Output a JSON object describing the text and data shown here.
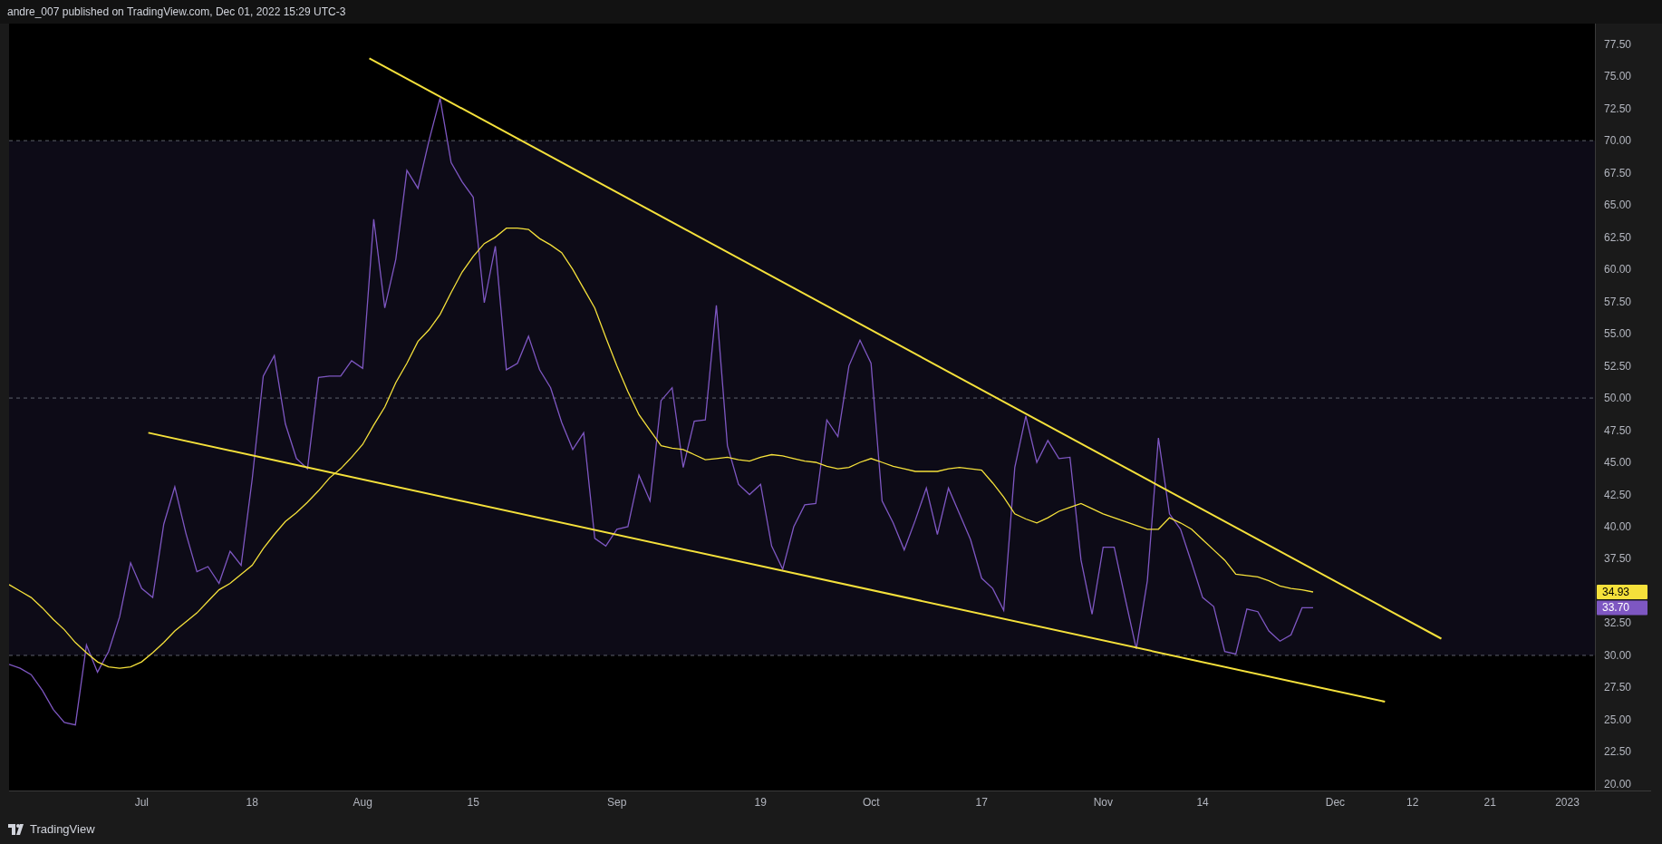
{
  "header": {
    "text": "andre_007 published on TradingView.com, Dec 01, 2022 15:29 UTC-3"
  },
  "chart": {
    "chart_data": {
      "type": "line",
      "categories": [
        null,
        null,
        null,
        null,
        null,
        null,
        null,
        null,
        null,
        null,
        null,
        null,
        "Jul",
        null,
        null,
        null,
        null,
        null,
        null,
        null,
        null,
        null,
        "18",
        null,
        null,
        null,
        null,
        null,
        null,
        null,
        null,
        null,
        "Aug",
        null,
        null,
        null,
        null,
        null,
        null,
        null,
        null,
        null,
        "15",
        null,
        null,
        null,
        null,
        null,
        null,
        null,
        null,
        null,
        null,
        null,
        null,
        "Sep",
        null,
        null,
        null,
        null,
        null,
        null,
        null,
        null,
        null,
        null,
        null,
        null,
        "19",
        null,
        null,
        null,
        null,
        null,
        null,
        null,
        null,
        null,
        "Oct",
        null,
        null,
        null,
        null,
        null,
        null,
        null,
        null,
        null,
        "17",
        null,
        null,
        null,
        null,
        null,
        null,
        null,
        null,
        null,
        null,
        "Nov",
        null,
        null,
        null,
        null,
        null,
        null,
        null,
        null,
        "14",
        null,
        null,
        null,
        null,
        null,
        null,
        null,
        null,
        null,
        null,
        null,
        "Dec",
        null,
        null,
        null,
        null,
        null,
        null,
        "12",
        null,
        null,
        null,
        null,
        null,
        null,
        "21",
        null,
        null,
        null,
        null,
        null,
        null,
        "2023"
      ],
      "series": [
        {
          "color": "#7e57c2",
          "values": [
            29.3,
            29.0,
            28.5,
            27.3,
            25.8,
            24.8,
            24.6,
            30.8,
            28.7,
            30.3,
            33.0,
            37.2,
            35.2,
            34.5,
            40.2,
            43.1,
            39.5,
            36.5,
            36.9,
            35.6,
            38.1,
            37.0,
            43.7,
            51.7,
            53.3,
            48.0,
            45.3,
            44.5,
            51.6,
            51.7,
            51.7,
            52.9,
            52.3,
            63.9,
            57.0,
            60.8,
            67.7,
            66.3,
            70.0,
            73.3,
            68.3,
            66.8,
            65.6,
            57.4,
            61.8,
            52.2,
            52.7,
            54.8,
            52.2,
            50.8,
            48.1,
            46.0,
            47.3,
            39.1,
            38.5,
            39.8,
            40.0,
            44.0,
            42.0,
            49.8,
            50.8,
            44.6,
            48.2,
            48.3,
            57.2,
            46.3,
            43.3,
            42.5,
            43.3,
            38.5,
            36.7,
            40.0,
            41.7,
            41.8,
            48.3,
            47.0,
            52.5,
            54.5,
            52.7,
            42.0,
            40.3,
            38.2,
            40.5,
            43.0,
            39.4,
            43.0,
            41.0,
            39.0,
            36.0,
            35.2,
            33.5,
            44.6,
            48.6,
            45.0,
            46.7,
            45.3,
            45.4,
            37.4,
            33.2,
            38.4,
            38.4,
            34.4,
            30.5,
            35.8,
            46.9,
            41.0,
            39.8,
            37.2,
            34.5,
            33.8,
            30.3,
            30.1,
            33.6,
            33.4,
            31.9,
            31.1,
            31.6,
            33.7,
            33.7,
            null,
            null,
            null,
            null,
            null,
            null,
            null,
            null,
            null,
            null,
            null,
            null,
            null,
            null,
            null,
            null,
            null,
            null,
            null,
            null,
            null,
            null,
            null
          ]
        },
        {
          "color": "#f5e13b",
          "values": [
            35.5,
            35.0,
            34.5,
            33.7,
            32.8,
            32.0,
            31.0,
            30.2,
            29.5,
            29.1,
            29.0,
            29.1,
            29.5,
            30.2,
            31.0,
            31.9,
            32.6,
            33.3,
            34.2,
            35.1,
            35.6,
            36.3,
            37.0,
            38.3,
            39.4,
            40.4,
            41.1,
            41.9,
            42.8,
            43.8,
            44.5,
            45.4,
            46.4,
            47.9,
            49.3,
            51.2,
            52.7,
            54.4,
            55.3,
            56.5,
            58.2,
            59.8,
            61.0,
            62.0,
            62.5,
            63.2,
            63.2,
            63.1,
            62.4,
            61.9,
            61.3,
            60.0,
            58.5,
            57.0,
            54.7,
            52.5,
            50.5,
            48.7,
            47.5,
            46.3,
            46.1,
            46.0,
            45.6,
            45.2,
            45.3,
            45.4,
            45.2,
            45.1,
            45.4,
            45.6,
            45.5,
            45.3,
            45.1,
            45.0,
            44.7,
            44.5,
            44.6,
            45.0,
            45.3,
            45.0,
            44.7,
            44.5,
            44.3,
            44.3,
            44.3,
            44.5,
            44.6,
            44.5,
            44.4,
            43.4,
            42.3,
            41.0,
            40.6,
            40.3,
            40.7,
            41.2,
            41.5,
            41.8,
            41.4,
            41.0,
            40.7,
            40.4,
            40.1,
            39.8,
            39.8,
            40.7,
            40.3,
            39.8,
            39.0,
            38.2,
            37.4,
            36.3,
            36.2,
            36.1,
            35.8,
            35.4,
            35.2,
            35.1,
            34.93,
            null,
            null,
            null,
            null,
            null,
            null,
            null,
            null,
            null,
            null,
            null,
            null,
            null,
            null,
            null,
            null,
            null,
            null,
            null,
            null,
            null,
            null,
            null
          ]
        }
      ],
      "ylim": [
        19.5,
        79.1
      ],
      "yticks": [
        {
          "value": 20,
          "label": "20.00"
        },
        {
          "value": 22.5,
          "label": "22.50"
        },
        {
          "value": 25,
          "label": "25.00"
        },
        {
          "value": 27.5,
          "label": "27.50"
        },
        {
          "value": 30,
          "label": "30.00"
        },
        {
          "value": 32.5,
          "label": "32.50"
        },
        {
          "value": 37.5,
          "label": "37.50"
        },
        {
          "value": 40,
          "label": "40.00"
        },
        {
          "value": 42.5,
          "label": "42.50"
        },
        {
          "value": 45,
          "label": "45.00"
        },
        {
          "value": 47.5,
          "label": "47.50"
        },
        {
          "value": 50,
          "label": "50.00"
        },
        {
          "value": 52.5,
          "label": "52.50"
        },
        {
          "value": 55,
          "label": "55.00"
        },
        {
          "value": 57.5,
          "label": "57.50"
        },
        {
          "value": 60,
          "label": "60.00"
        },
        {
          "value": 62.5,
          "label": "62.50"
        },
        {
          "value": 65,
          "label": "65.00"
        },
        {
          "value": 67.5,
          "label": "67.50"
        },
        {
          "value": 70,
          "label": "70.00"
        },
        {
          "value": 72.5,
          "label": "72.50"
        },
        {
          "value": 75,
          "label": "75.00"
        },
        {
          "value": 77.5,
          "label": "77.50"
        }
      ],
      "bands": [
        {
          "axis": "y",
          "from": 30,
          "to": 70
        }
      ],
      "ref_lines": [
        {
          "axis": "y",
          "value": 70
        },
        {
          "axis": "y",
          "value": 50
        },
        {
          "axis": "y",
          "value": 30
        }
      ]
    },
    "trend_lines": [
      {
        "color": "#f5e13b"
      },
      {
        "color": "#f5e13b"
      }
    ],
    "price_labels": [
      {
        "label": "34.93",
        "color": "#f5e13b"
      },
      {
        "label": "33.70",
        "color": "#7e57c2"
      }
    ]
  },
  "footer": {
    "brand": "TradingView"
  }
}
